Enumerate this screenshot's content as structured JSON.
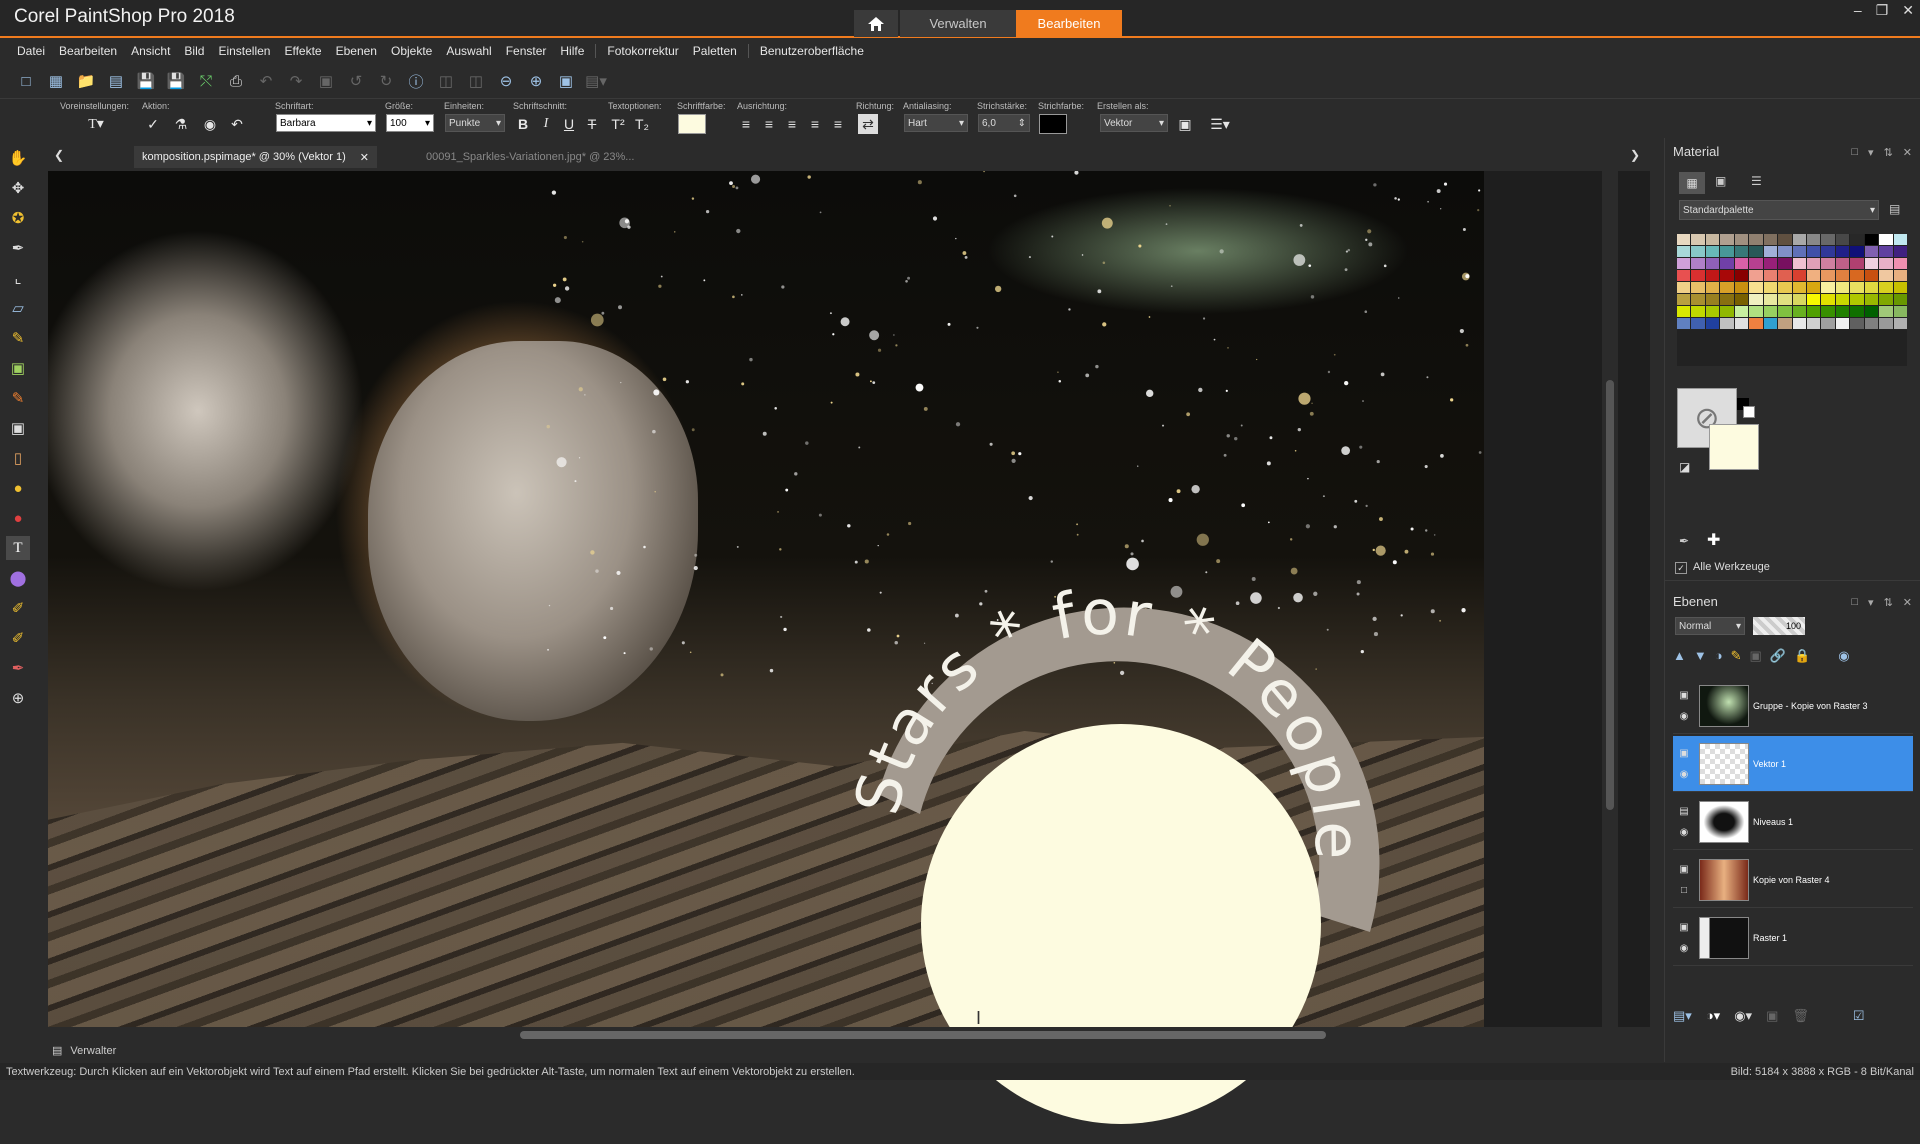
{
  "app": {
    "title": "Corel PaintShop Pro 2018"
  },
  "workspace_tabs": {
    "home_icon": "home-icon",
    "manage": "Verwalten",
    "edit": "Bearbeiten"
  },
  "menu": [
    "Datei",
    "Bearbeiten",
    "Ansicht",
    "Bild",
    "Einstellen",
    "Effekte",
    "Ebenen",
    "Objekte",
    "Auswahl",
    "Fenster",
    "Hilfe",
    "Fotokorrektur",
    "Paletten",
    "Benutzeroberfläche"
  ],
  "options": {
    "presets_label": "Voreinstellungen:",
    "action_label": "Aktion:",
    "font_label": "Schriftart:",
    "font_value": "Barbara",
    "size_label": "Größe:",
    "size_value": "100",
    "units_label": "Einheiten:",
    "units_value": "Punkte",
    "style_label": "Schriftschnitt:",
    "text_options_label": "Textoptionen:",
    "font_color_label": "Schriftfarbe:",
    "align_label": "Ausrichtung:",
    "direction_label": "Richtung:",
    "antialias_label": "Antialiasing:",
    "antialias_value": "Hart",
    "stroke_width_label": "Strichstärke:",
    "stroke_width_value": "6,0",
    "stroke_color_label": "Strichfarbe:",
    "create_as_label": "Erstellen als:",
    "create_as_value": "Vektor",
    "bold": "B",
    "italic": "I",
    "underline": "U",
    "strike": "T"
  },
  "document_tabs": [
    {
      "label": "komposition.pspimage* @  30% (Vektor 1)"
    },
    {
      "label": "00091_Sparkles-Variationen.jpg* @  23%..."
    }
  ],
  "canvas": {
    "curved_text": "Stars * for * People"
  },
  "material_panel": {
    "title": "Material",
    "palette_select": "Standardpalette",
    "all_tools_label": "Alle Werkzeuge",
    "swatch_colors": [
      "#e8d8c0",
      "#d8c8b0",
      "#c8b8a0",
      "#b0a090",
      "#a09080",
      "#908070",
      "#807060",
      "#605040",
      "#a8a8a8",
      "#888888",
      "#686868",
      "#484848",
      "#282828",
      "#000000",
      "#ffffff",
      "#c0e8f0",
      "#a8d8d8",
      "#88c8c8",
      "#68b8b8",
      "#489898",
      "#387878",
      "#285858",
      "#a0b0d8",
      "#8090c8",
      "#6070b8",
      "#4050a8",
      "#303898",
      "#202088",
      "#101078",
      "#8060b0",
      "#6040a0",
      "#402080",
      "#d0a0d8",
      "#b080c8",
      "#9060b8",
      "#7040a8",
      "#d860a8",
      "#b84090",
      "#982078",
      "#781060",
      "#f0c0d0",
      "#e0a0b8",
      "#d080a0",
      "#c06088",
      "#b04070",
      "#f0d0e0",
      "#e8b0c8",
      "#f090b0",
      "#e85050",
      "#d83030",
      "#c01818",
      "#a80808",
      "#880000",
      "#f0a090",
      "#e88070",
      "#e06050",
      "#d84030",
      "#f0b080",
      "#e89860",
      "#e08040",
      "#d86820",
      "#c85010",
      "#f0c8a0",
      "#e8b080",
      "#f0d088",
      "#e8c068",
      "#e0b048",
      "#d8a028",
      "#c89010",
      "#f8e090",
      "#f0d870",
      "#e8c850",
      "#e0b830",
      "#d8a810",
      "#f8f0a0",
      "#f0e880",
      "#e8e060",
      "#e0d840",
      "#d8d020",
      "#c8c000",
      "#b8a040",
      "#a89030",
      "#988020",
      "#887010",
      "#786000",
      "#f0f0c0",
      "#e8e8a0",
      "#e0e080",
      "#d8d860",
      "#f8f800",
      "#e0e000",
      "#c8d800",
      "#b0c800",
      "#98b800",
      "#80a800",
      "#689800",
      "#d8e800",
      "#c0d800",
      "#a8c800",
      "#90b800",
      "#c8f0a0",
      "#b0e080",
      "#98d060",
      "#80c040",
      "#68b020",
      "#50a000",
      "#389000",
      "#208000",
      "#107000",
      "#006000",
      "#a0c878",
      "#88b860",
      "#6080c0",
      "#4060b0",
      "#2040a0",
      "#c0c0c0",
      "#e0e0e0",
      "#f08040",
      "#30a0d0",
      "#c0a080",
      "#e8e8e8",
      "#d0d0d0",
      "#a0a0a0",
      "#f0f0f0",
      "#606060",
      "#808080",
      "#9a9a9a",
      "#b0b0b0"
    ]
  },
  "layers_panel": {
    "title": "Ebenen",
    "blend_mode": "Normal",
    "opacity": "100",
    "layers": [
      {
        "name": "Gruppe - Kopie von Raster 3",
        "selected": false
      },
      {
        "name": "Vektor 1",
        "selected": true
      },
      {
        "name": "Niveaus 1",
        "selected": false
      },
      {
        "name": "Kopie von Raster 4",
        "selected": false
      },
      {
        "name": "Raster 1",
        "selected": false
      }
    ]
  },
  "bottom": {
    "manage_label": "Verwalter"
  },
  "status": {
    "hint": "Textwerkzeug: Durch Klicken auf ein Vektorobjekt wird Text auf einem Pfad erstellt. Klicken Sie bei gedrückter Alt-Taste, um normalen Text auf einem Vektorobjekt zu erstellen.",
    "image_info": "Bild:  5184 x 3888 x RGB - 8 Bit/Kanal"
  },
  "colors": {
    "accent": "#f07b1e",
    "selection": "#3d8ee8",
    "badge_fill": "#fdfbe0",
    "badge_ring": "#a39a90"
  }
}
